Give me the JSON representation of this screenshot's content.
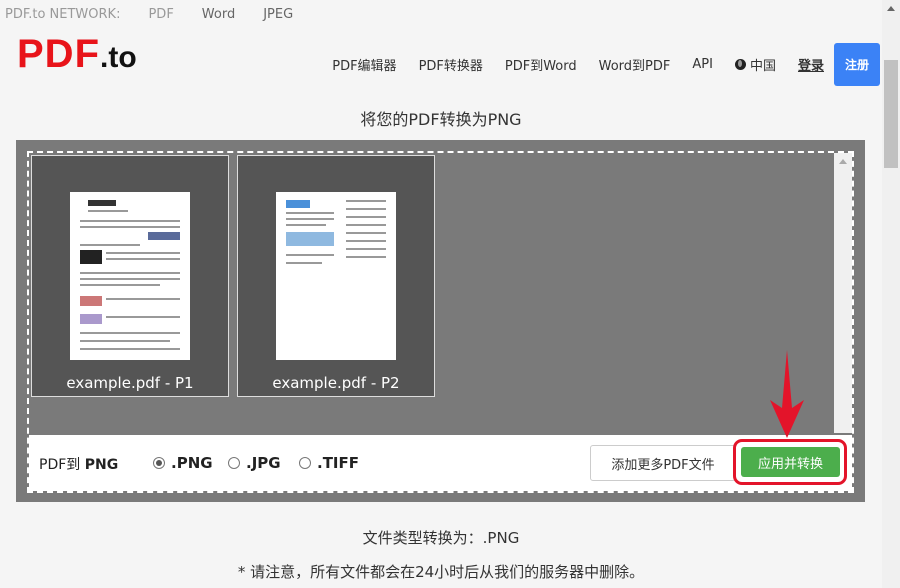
{
  "network": {
    "label": "PDF.to NETWORK:",
    "links": [
      "PDF",
      "Word",
      "JPEG"
    ]
  },
  "logo": {
    "main": "PDF",
    "suffix": ".to"
  },
  "nav": {
    "items": [
      "PDF编辑器",
      "PDF转换器",
      "PDF到Word",
      "Word到PDF",
      "API"
    ],
    "language": "中国",
    "login": "登录",
    "register": "注册"
  },
  "title": "将您的PDF转换为PNG",
  "thumbnails": [
    {
      "caption": "example.pdf - P1"
    },
    {
      "caption": "example.pdf - P2"
    }
  ],
  "controls": {
    "label_prefix": "PDF到",
    "label_format": "PNG",
    "formats": [
      {
        "label": ".PNG",
        "selected": true
      },
      {
        "label": ".JPG",
        "selected": false
      },
      {
        "label": ".TIFF",
        "selected": false
      }
    ],
    "add_more": "添加更多PDF文件",
    "apply": "应用并转换"
  },
  "filetype": "文件类型转换为：.PNG",
  "notice": "* 请注意，所有文件都会在24小时后从我们的服务器中删除。",
  "colors": {
    "logo_red": "#e8141a",
    "register_blue": "#3b82f6",
    "apply_green": "#4cae4c",
    "highlight_red": "#e3142a"
  }
}
